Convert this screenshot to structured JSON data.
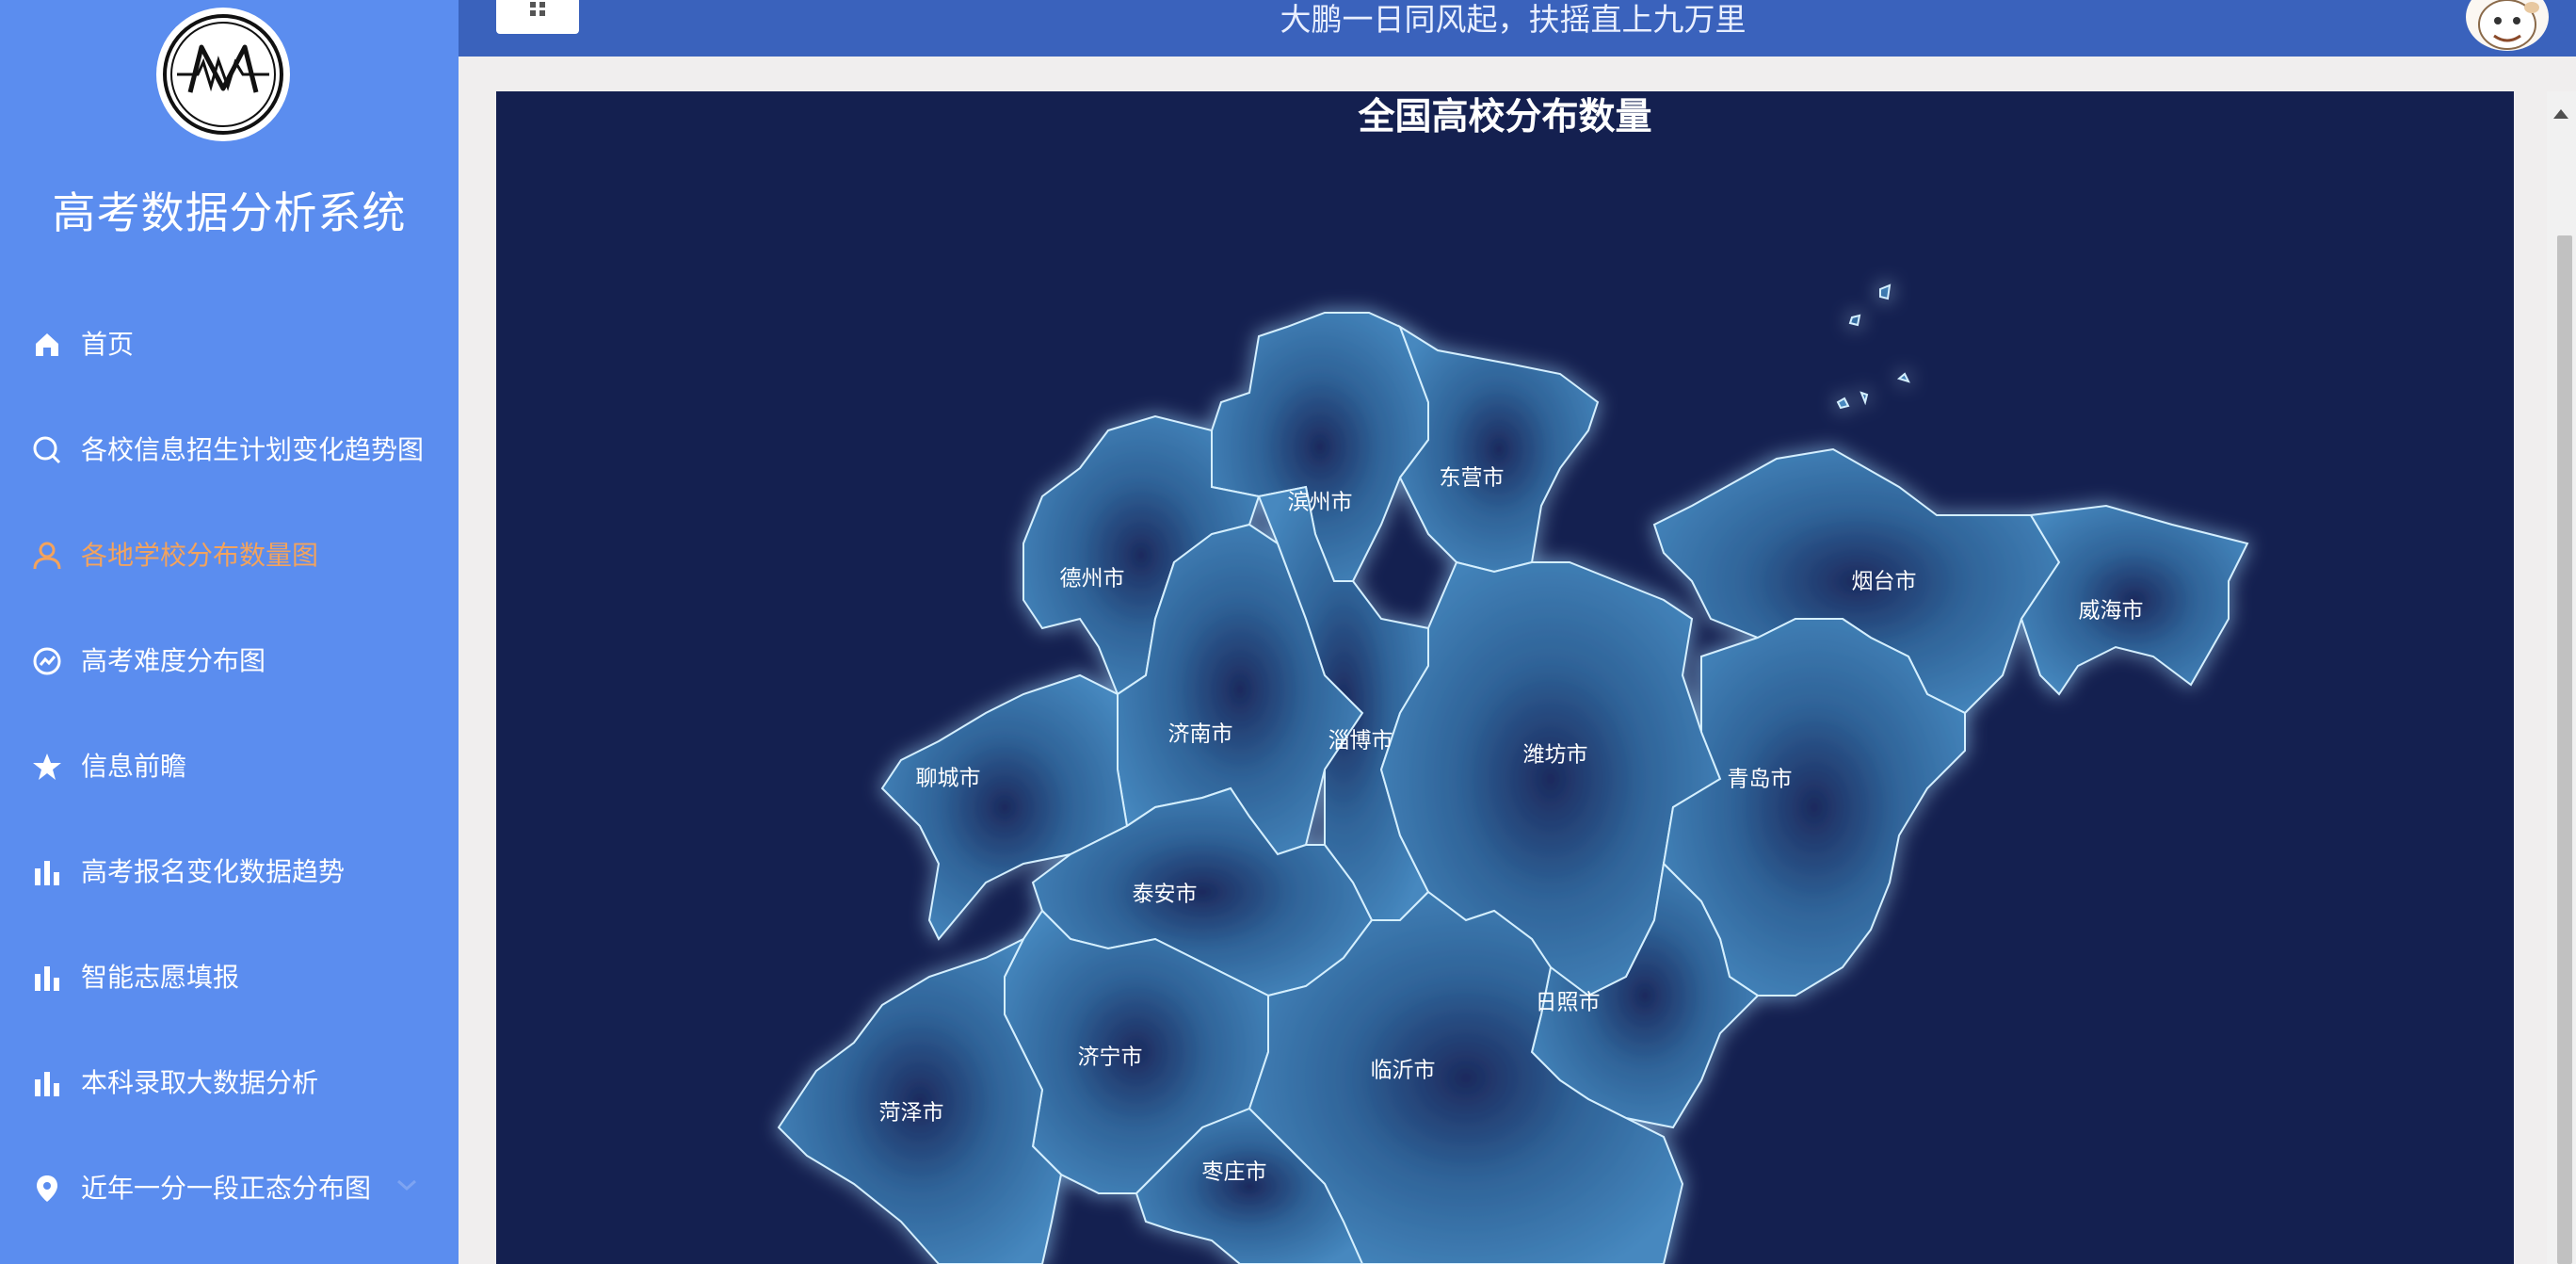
{
  "sidebar": {
    "title": "高考数据分析系统",
    "items": [
      {
        "label": "首页",
        "icon": "home-icon"
      },
      {
        "label": "各校信息招生计划变化趋势图",
        "icon": "search-icon"
      },
      {
        "label": "各地学校分布数量图",
        "icon": "user-icon",
        "active": true
      },
      {
        "label": "高考难度分布图",
        "icon": "gauge-icon"
      },
      {
        "label": "信息前瞻",
        "icon": "star-icon"
      },
      {
        "label": "高考报名变化数据趋势",
        "icon": "bar-chart-icon"
      },
      {
        "label": "智能志愿填报",
        "icon": "bar-chart-icon"
      },
      {
        "label": "本科录取大数据分析",
        "icon": "bar-chart-icon"
      },
      {
        "label": "近年一分一段正态分布图",
        "icon": "location-pin-icon"
      }
    ]
  },
  "header": {
    "motto": "大鹏一日同风起，扶摇直上九万里"
  },
  "map": {
    "title": "全国高校分布数量",
    "cities": [
      "滨州市",
      "东营市",
      "德州市",
      "烟台市",
      "威海市",
      "济南市",
      "淄博市",
      "潍坊市",
      "聊城市",
      "青岛市",
      "泰安市",
      "日照市",
      "济宁市",
      "临沂市",
      "菏泽市",
      "枣庄市"
    ]
  },
  "colors": {
    "sidebar": "#5b8def",
    "header": "#3a62bc",
    "active": "#f3a35d",
    "map_background": "#142050",
    "region_fill": "#3a78b0",
    "region_border": "#bfe6ff"
  }
}
